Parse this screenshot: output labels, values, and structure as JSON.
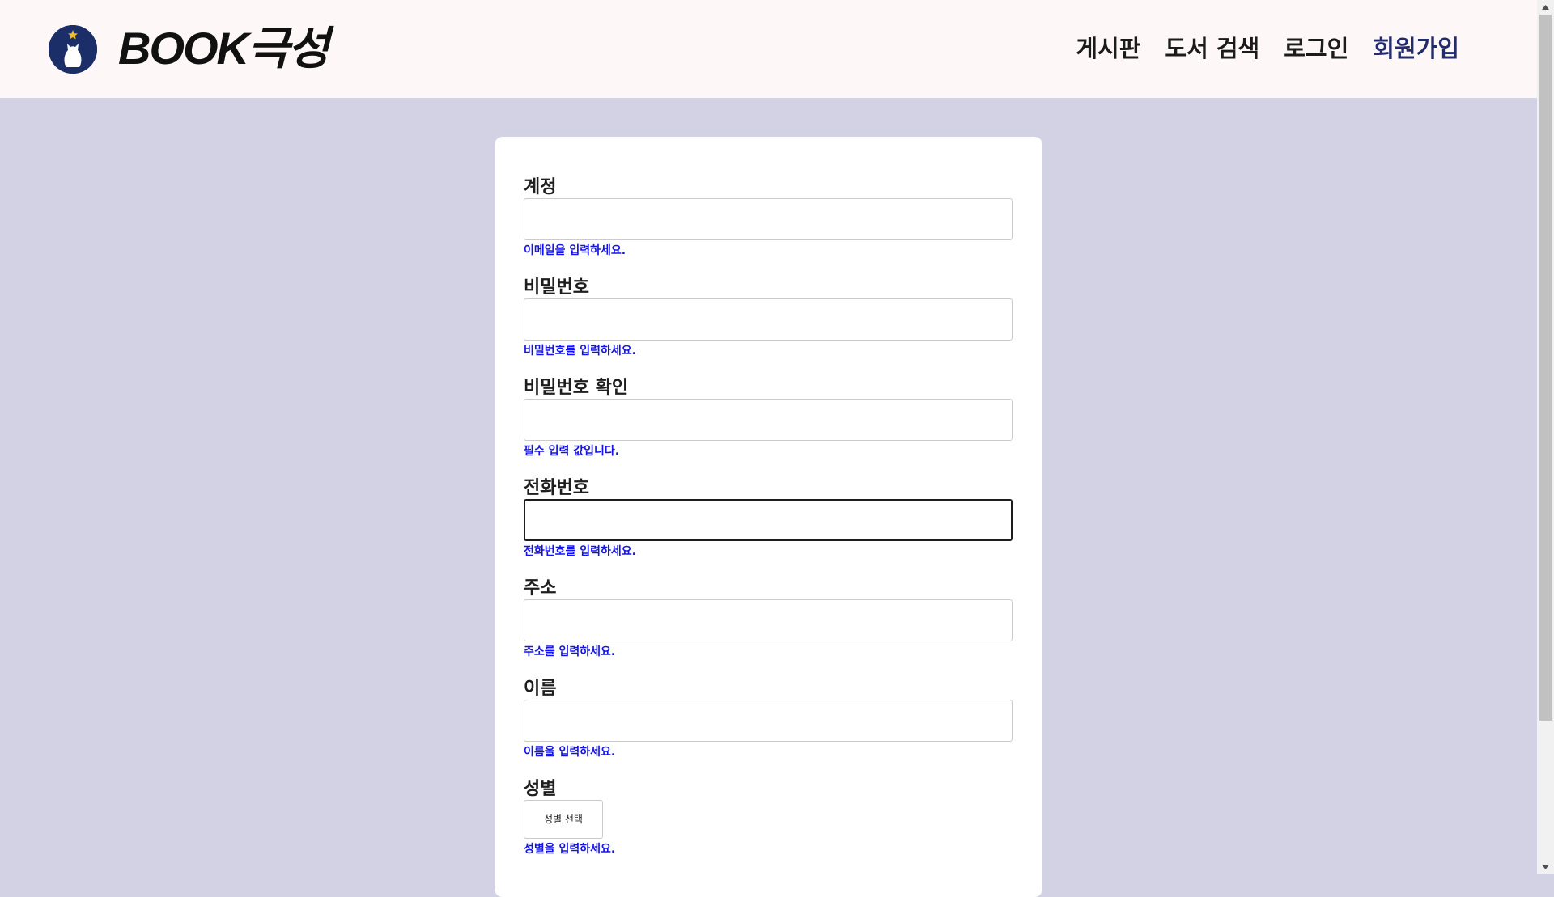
{
  "brand": {
    "name": "BOOK극성"
  },
  "nav": {
    "items": [
      {
        "label": "게시판"
      },
      {
        "label": "도서 검색"
      },
      {
        "label": "로그인"
      },
      {
        "label": "회원가입"
      }
    ]
  },
  "form": {
    "fields": [
      {
        "label": "계정",
        "value": "",
        "hint": "이메일을 입력하세요."
      },
      {
        "label": "비밀번호",
        "value": "",
        "hint": "비밀번호를 입력하세요."
      },
      {
        "label": "비밀번호 확인",
        "value": "",
        "hint": "필수 입력 값입니다."
      },
      {
        "label": "전화번호",
        "value": "",
        "hint": "전화번호를 입력하세요."
      },
      {
        "label": "주소",
        "value": "",
        "hint": "주소를 입력하세요."
      },
      {
        "label": "이름",
        "value": "",
        "hint": "이름을 입력하세요."
      }
    ],
    "gender": {
      "label": "성별",
      "select_label": "성별 선택",
      "hint": "성별을 입력하세요."
    }
  },
  "colors": {
    "page_bg": "#d3d2e5",
    "header_bg": "#fdf8f7",
    "hint_text": "#1414e6",
    "active_nav": "#232c6b",
    "logo_circle": "#1c2e68"
  },
  "icons": {
    "logo": "cat-star-logo-icon",
    "scroll_up": "triangle-up-icon",
    "scroll_down": "triangle-down-icon"
  }
}
